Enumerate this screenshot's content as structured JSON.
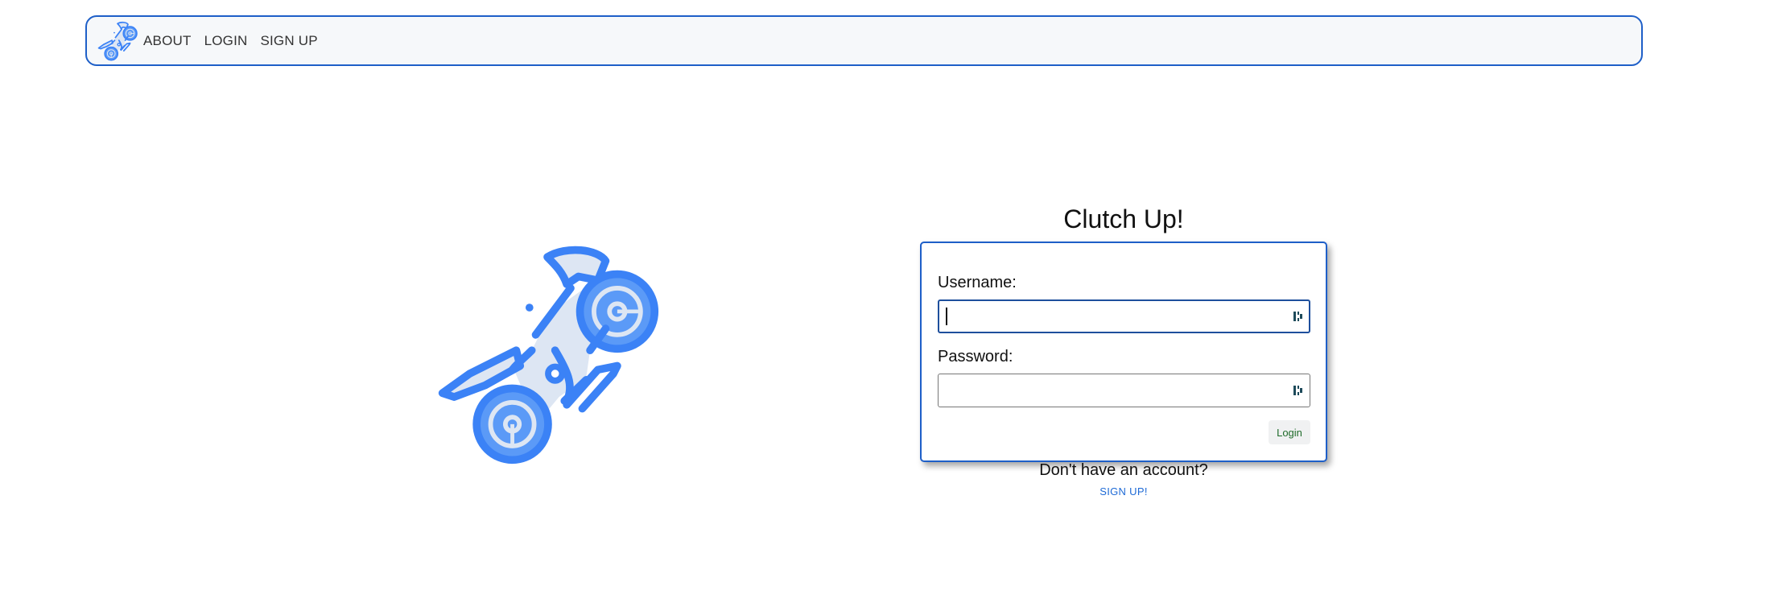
{
  "navbar": {
    "logo_icon": "motorcycle-wheelie-icon",
    "links": [
      {
        "label": "ABOUT"
      },
      {
        "label": "LOGIN"
      },
      {
        "label": "SIGN UP"
      }
    ]
  },
  "hero": {
    "icon": "motorcycle-wheelie-icon"
  },
  "login": {
    "title": "Clutch Up!",
    "username_label": "Username:",
    "username_value": "",
    "password_label": "Password:",
    "password_value": "",
    "submit_label": "Login",
    "no_account_text": "Don't have an account?",
    "signup_link_label": "SIGN UP!"
  },
  "colors": {
    "accent": "#1e5fc8",
    "icon_blue": "#3b82f6",
    "icon_fill": "#dde6f3",
    "link": "#1e6ad6",
    "login_text": "#1f6b2a"
  }
}
